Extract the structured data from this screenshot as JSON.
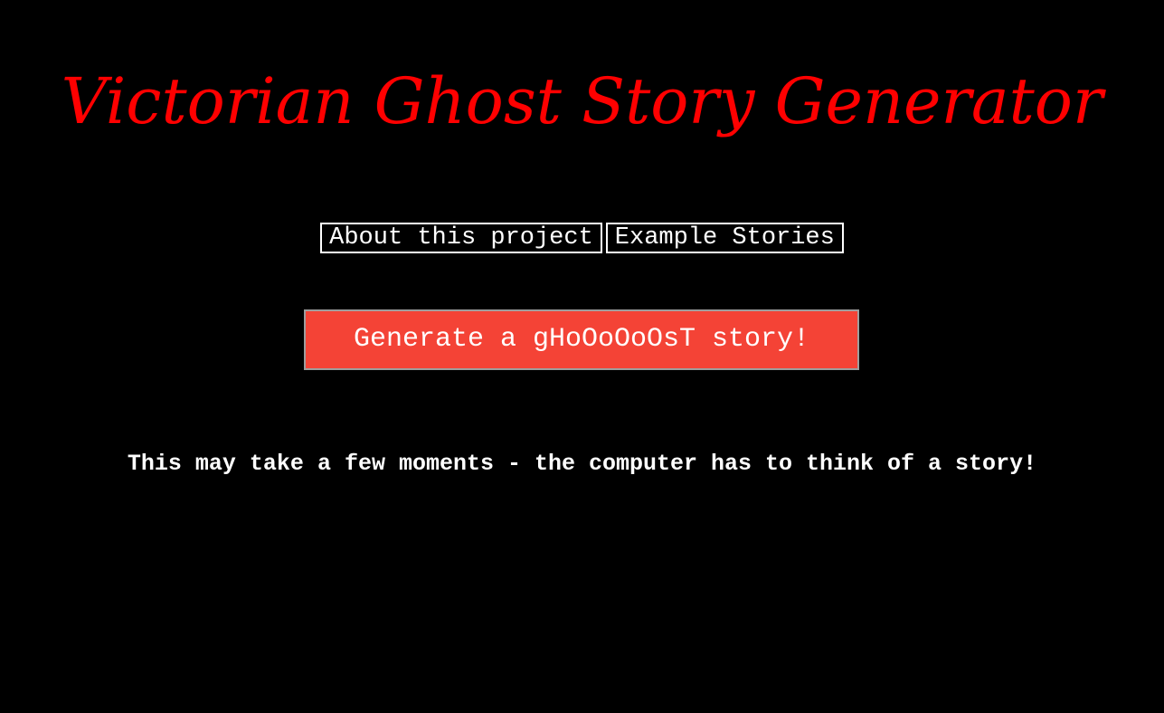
{
  "header": {
    "title": "Victorian Ghost Story Generator"
  },
  "nav": {
    "about_label": "About this project",
    "examples_label": "Example Stories"
  },
  "main": {
    "generate_label": "Generate a gHoOoOoOsT story!",
    "note": "This may take a few moments - the computer has to think of a story!"
  },
  "colors": {
    "background": "#000000",
    "title": "#ff0000",
    "button": "#f44336",
    "text": "#ffffff"
  }
}
